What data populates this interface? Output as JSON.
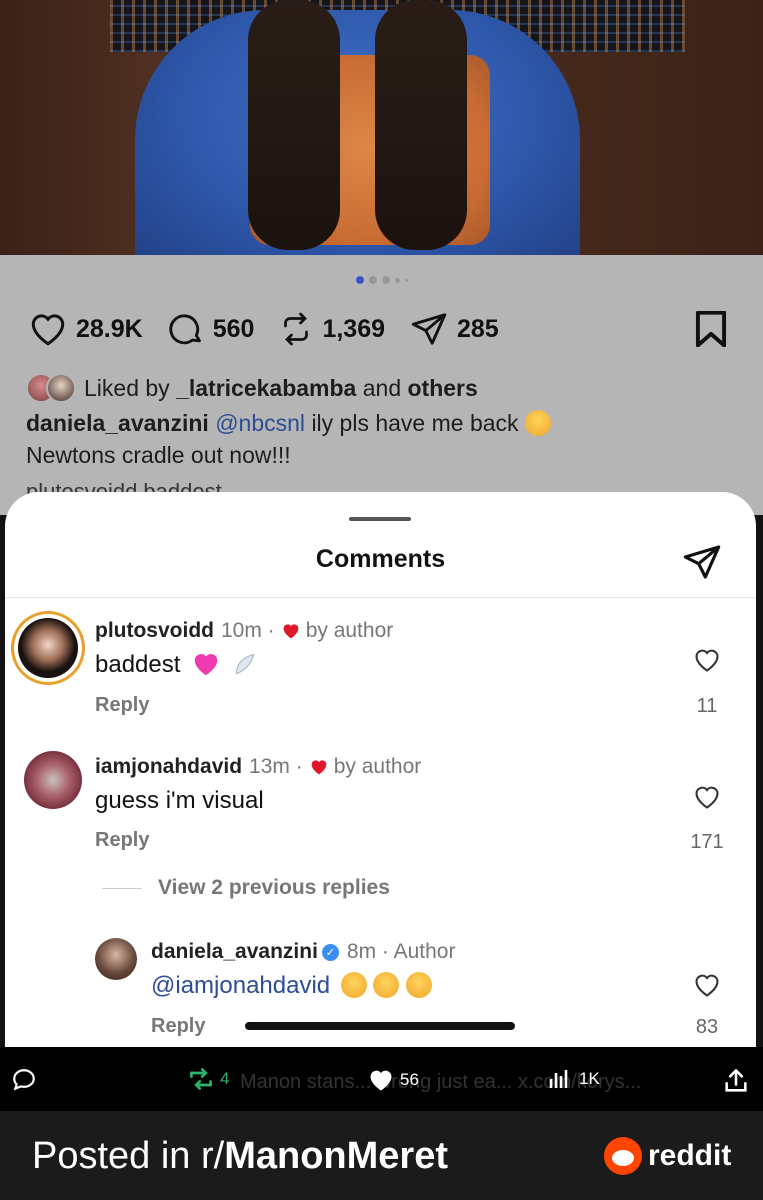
{
  "post": {
    "likes": "28.9K",
    "comments": "560",
    "reposts": "1,369",
    "shares": "285",
    "liked_by_prefix": "Liked by",
    "liked_by_user": "_latricekabamba",
    "liked_by_and": "and",
    "liked_by_others": "others",
    "caption_user": "daniela_avanzini",
    "caption_mention": "@nbcsnl",
    "caption_text": "ily pls have me back",
    "caption_line2": "Newtons cradle out now!!!",
    "peek_text": "plutosvoidd baddest",
    "carousel_active_index": 0
  },
  "sheet": {
    "title": "Comments",
    "comments": [
      {
        "user": "plutosvoidd",
        "time": "10m ·",
        "tag": "by author",
        "text": "baddest",
        "reply": "Reply",
        "likes": "11"
      },
      {
        "user": "iamjonahdavid",
        "time": "13m ·",
        "tag": "by author",
        "text": "guess i'm visual",
        "reply": "Reply",
        "likes": "171"
      },
      {
        "user": "daniela_avanzini",
        "time": "8m · Author",
        "text": "@iamjonahdavid",
        "reply": "Reply",
        "likes": "83"
      }
    ],
    "view_previous": "View 2 previous replies"
  },
  "tweet": {
    "retweets": "4",
    "likes": "56",
    "views": "1K",
    "ghost_text": "Manon stans... wrong just ea... x.com/korys..."
  },
  "footer": {
    "posted_in": "Posted in r/",
    "subreddit": "ManonMeret",
    "brand": "reddit"
  },
  "colors": {
    "mention": "#2c4c94",
    "retweet": "#2ab36a",
    "reddit_orange": "#ff4500",
    "carousel_active": "#3b55c9"
  }
}
